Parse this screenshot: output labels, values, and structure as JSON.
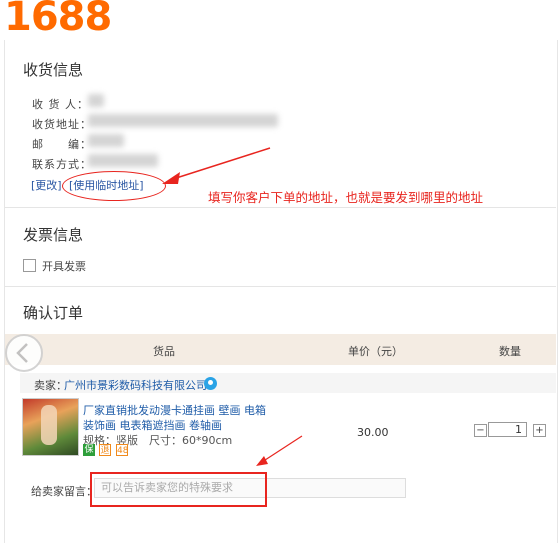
{
  "brand": {
    "logo_text": "1688",
    "color": "#ff6a00"
  },
  "receiving": {
    "title": "收货信息",
    "fields": {
      "recipient_label": "收 货 人：",
      "address_label": "收货地址：",
      "postcode_label": "邮　　编：",
      "contact_label": "联系方式："
    },
    "change_link": "[更改]",
    "temp_address_link": "[使用临时地址]"
  },
  "annotation": {
    "text": "填写你客户下单的地址，也就是要发到哪里的地址",
    "color": "#e8251f"
  },
  "invoice": {
    "title": "发票信息",
    "checkbox_label": "开具发票",
    "checked": false
  },
  "order": {
    "title": "确认订单",
    "columns": {
      "goods": "货品",
      "unit_price": "单价（元）",
      "quantity": "数量"
    },
    "seller": {
      "prefix": "卖家：",
      "name": "广州市景彩数码科技有限公司"
    },
    "item": {
      "title_line1": "厂家直销批发动漫卡通挂画 壁画 电箱",
      "title_line2": "装饰画 电表箱遮挡画 卷轴画",
      "spec_label": "规格：竖版",
      "size_label": "尺寸：60*90cm",
      "badges": [
        "保",
        "退",
        "48"
      ],
      "price": "30.00",
      "qty_minus": "−",
      "qty_value": "1",
      "qty_plus": "+"
    },
    "message": {
      "label": "给卖家留言：",
      "placeholder": "可以告诉卖家您的特殊要求"
    }
  }
}
